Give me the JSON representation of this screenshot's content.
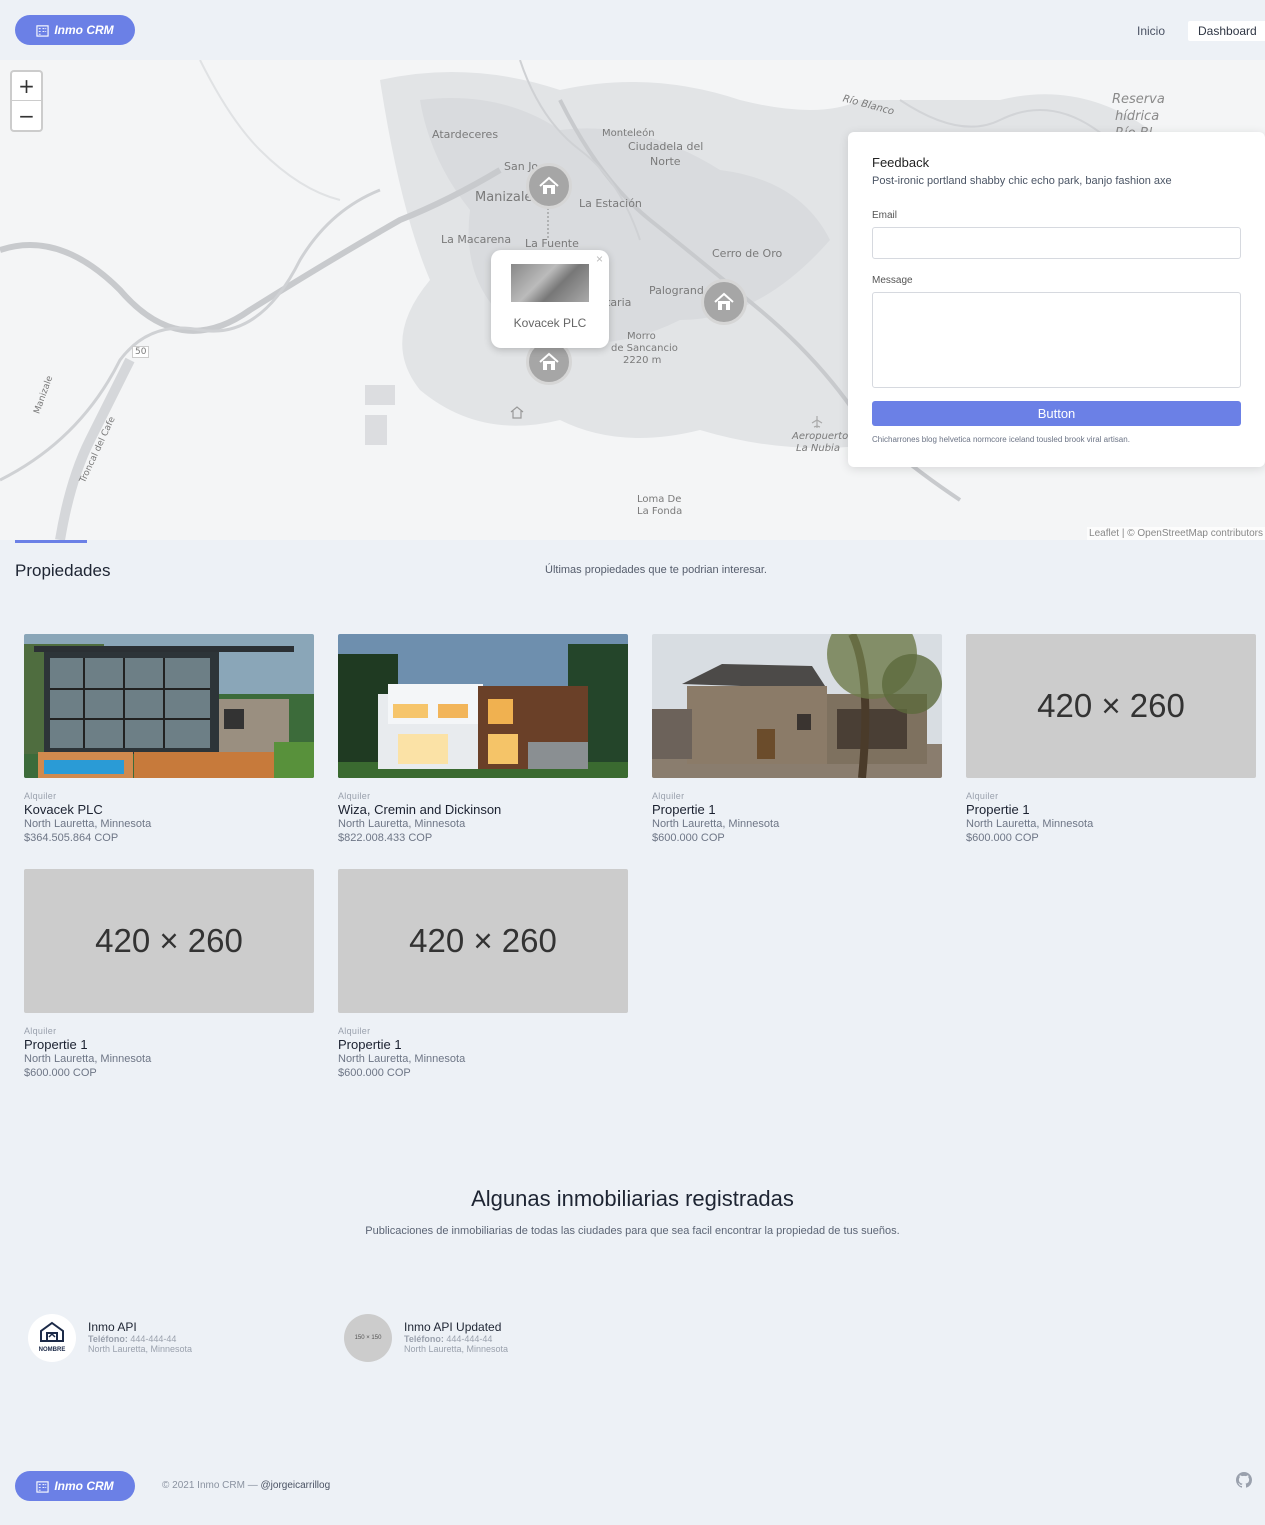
{
  "header": {
    "logo": "Inmo CRM",
    "nav": [
      "Inicio",
      "Dashboard"
    ]
  },
  "map": {
    "zoom_in": "+",
    "zoom_out": "−",
    "places": [
      {
        "name": "Atardeceres"
      },
      {
        "name": "Monteleón"
      },
      {
        "name": "Ciudadela del"
      },
      {
        "name": "Norte"
      },
      {
        "name": "San Jo"
      },
      {
        "name": "Manizale"
      },
      {
        "name": "La Estación"
      },
      {
        "name": "La Macarena"
      },
      {
        "name": "La Fuente"
      },
      {
        "name": "Cerro de Oro"
      },
      {
        "name": "Palogrand"
      },
      {
        "name": "taria"
      },
      {
        "name": "Morro"
      },
      {
        "name": "de Sancancio"
      },
      {
        "name": "2220 m"
      },
      {
        "name": "Aeropuerto"
      },
      {
        "name": "La Nubia"
      },
      {
        "name": "Loma De"
      },
      {
        "name": "La Fonda"
      },
      {
        "name": "Río Blanco"
      },
      {
        "name": "Reserva"
      },
      {
        "name": "hídrica"
      },
      {
        "name": "Río Bl"
      },
      {
        "name": "50"
      },
      {
        "name": "Manizale"
      },
      {
        "name": "Troncal del Cafe"
      }
    ],
    "popup_label": "Kovacek PLC",
    "popup_close": "×",
    "attribution": "Leaflet | © OpenStreetMap contributors"
  },
  "feedback": {
    "title": "Feedback",
    "subtitle": "Post-ironic portland shabby chic echo park, banjo fashion axe",
    "email_label": "Email",
    "email_value": "",
    "message_label": "Message",
    "message_value": "",
    "button": "Button",
    "note": "Chicharrones blog helvetica normcore iceland tousled brook viral artisan."
  },
  "properties": {
    "title": "Propiedades",
    "subtitle": "Últimas propiedades que te podrian interesar.",
    "items": [
      {
        "kind": "Alquiler",
        "name": "Kovacek PLC",
        "location": "North Lauretta, Minnesota",
        "price": "$364.505.864 COP",
        "image": "modern-glass-house"
      },
      {
        "kind": "Alquiler",
        "name": "Wiza, Cremin and Dickinson",
        "location": "North Lauretta, Minnesota",
        "price": "$822.008.433 COP",
        "image": "white-wood-house"
      },
      {
        "kind": "Alquiler",
        "name": "Propertie 1",
        "location": "North Lauretta, Minnesota",
        "price": "$600.000 COP",
        "image": "adobe-house"
      },
      {
        "kind": "Alquiler",
        "name": "Propertie 1",
        "location": "North Lauretta, Minnesota",
        "price": "$600.000 COP",
        "image": "420 × 260"
      },
      {
        "kind": "Alquiler",
        "name": "Propertie 1",
        "location": "North Lauretta, Minnesota",
        "price": "$600.000 COP",
        "image": "420 × 260"
      },
      {
        "kind": "Alquiler",
        "name": "Propertie 1",
        "location": "North Lauretta, Minnesota",
        "price": "$600.000 COP",
        "image": "420 × 260"
      }
    ]
  },
  "agencies": {
    "title": "Algunas inmobiliarias registradas",
    "subtitle": "Publicaciones de inmobiliarias de todas las ciudades para que sea facil encontrar la propiedad de tus sueños.",
    "items": [
      {
        "name": "Inmo API",
        "phone_label": "Teléfono:",
        "phone": "444-444-44",
        "location": "North Lauretta, Minnesota",
        "logo_text": "NOMBRE"
      },
      {
        "name": "Inmo API Updated",
        "phone_label": "Teléfono:",
        "phone": "444-444-44",
        "location": "North Lauretta, Minnesota",
        "logo_text": "150 × 150"
      }
    ]
  },
  "footer": {
    "logo": "Inmo CRM",
    "copyright": "© 2021 Inmo CRM —",
    "handle": "@jorgeicarrillog",
    "icon": "github-icon"
  },
  "colors": {
    "accent": "#6b80e6",
    "background": "#edf1f6"
  }
}
